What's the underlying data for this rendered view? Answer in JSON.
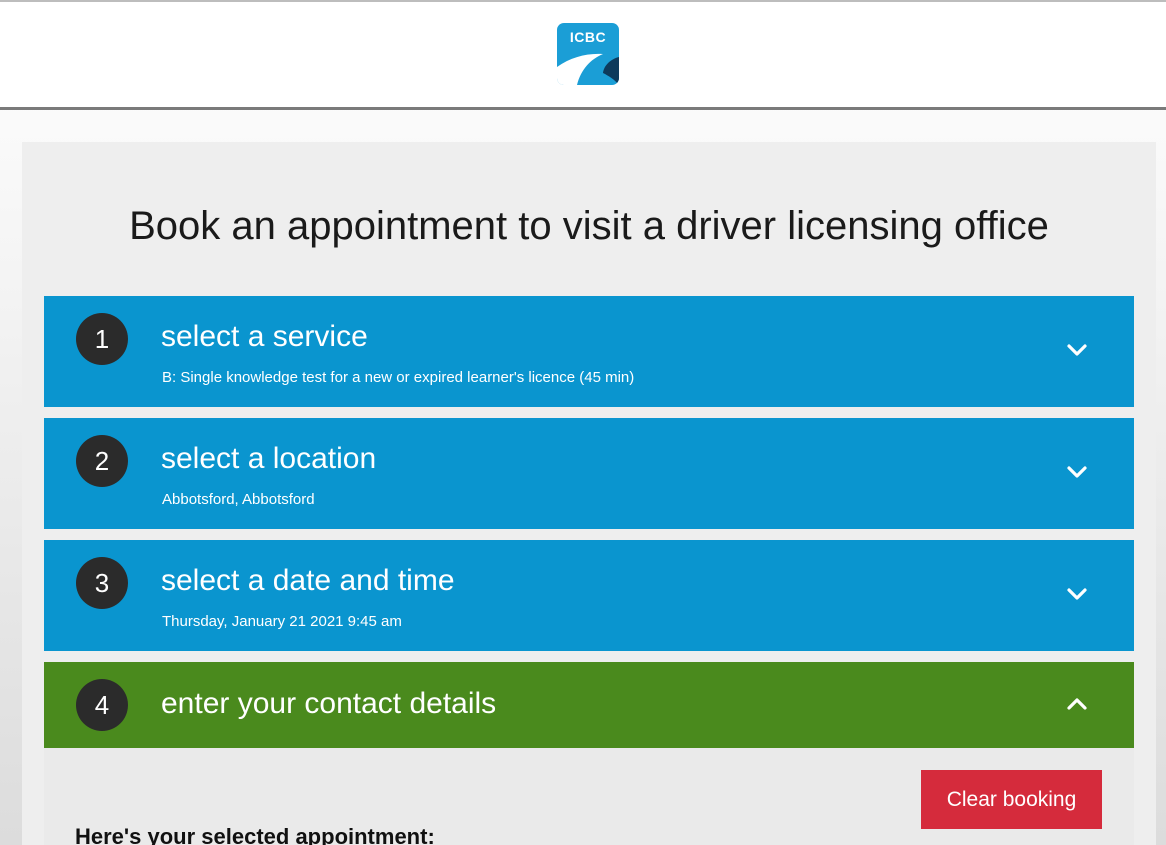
{
  "header": {
    "logo_text": "ICBC"
  },
  "page": {
    "title": "Book an appointment to visit a driver licensing office"
  },
  "steps": [
    {
      "number": "1",
      "title": "select a service",
      "subtitle": "B: Single knowledge test for a new or expired learner's licence (45 min)",
      "icon": "chevron-down-icon",
      "expanded": false
    },
    {
      "number": "2",
      "title": "select a location",
      "subtitle": "Abbotsford, Abbotsford",
      "icon": "chevron-down-icon",
      "expanded": false
    },
    {
      "number": "3",
      "title": "select a date and time",
      "subtitle": "Thursday, January 21 2021 9:45 am",
      "icon": "chevron-down-icon",
      "expanded": false
    },
    {
      "number": "4",
      "title": "enter your contact details",
      "icon": "chevron-up-icon",
      "expanded": true
    }
  ],
  "contact_section": {
    "clear_button_label": "Clear booking",
    "appointment_heading": "Here's your selected appointment:"
  },
  "colors": {
    "step_complete": "#0a95cf",
    "step_active": "#4a8a1d",
    "clear_button": "#d52b3c",
    "logo": "#1b9ed6"
  }
}
